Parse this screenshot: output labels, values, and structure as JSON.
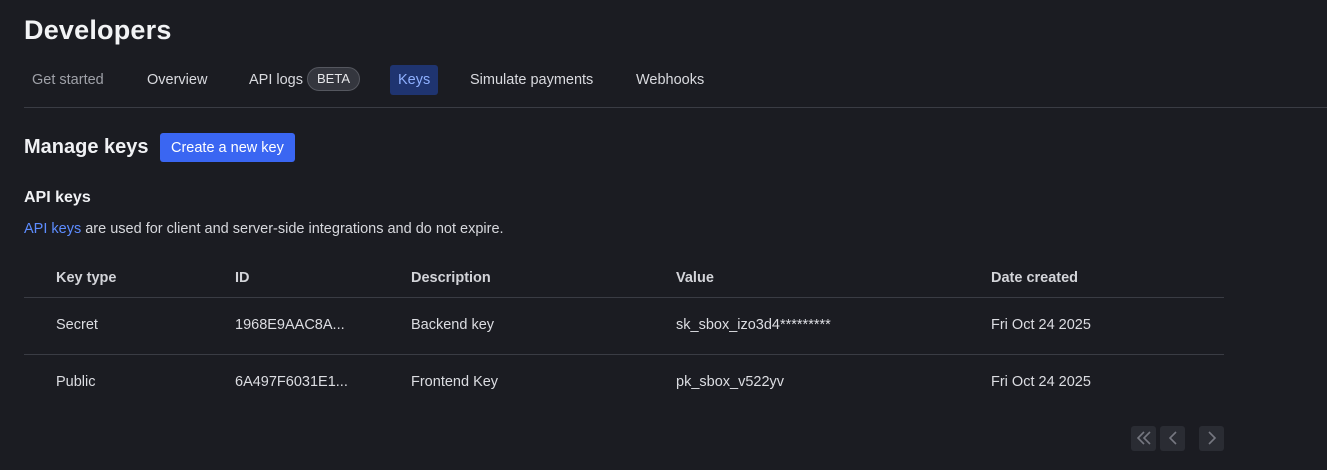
{
  "header": {
    "title": "Developers"
  },
  "tabs": [
    {
      "label": "Get started"
    },
    {
      "label": "Overview"
    },
    {
      "label": "API logs",
      "badge": "BETA"
    },
    {
      "label": "Keys"
    },
    {
      "label": "Simulate payments"
    },
    {
      "label": "Webhooks"
    }
  ],
  "active_tab": "Keys",
  "manage": {
    "title": "Manage keys",
    "create_button": "Create a new key"
  },
  "api_keys": {
    "title": "API keys",
    "link_text": "API keys",
    "description_rest": " are used for client and server-side integrations and do not expire."
  },
  "table": {
    "headers": [
      "Key type",
      "ID",
      "Description",
      "Value",
      "Date created"
    ],
    "rows": [
      [
        "Secret",
        "1968E9AAC8A...",
        "Backend key",
        "sk_sbox_izo3d4*********",
        "Fri Oct 24 2025"
      ],
      [
        "Public",
        "6A497F6031E1...",
        "Frontend Key",
        "pk_sbox_v522yv",
        "Fri Oct 24 2025"
      ]
    ]
  },
  "pagination": {
    "icons": [
      "double-chevron-left-icon",
      "chevron-left-icon",
      "chevron-right-icon"
    ]
  },
  "colors": {
    "background": "#1b1c22",
    "accent": "#3a66f2",
    "active_tab_bg": "#1f3470",
    "link": "#5d8cff"
  }
}
